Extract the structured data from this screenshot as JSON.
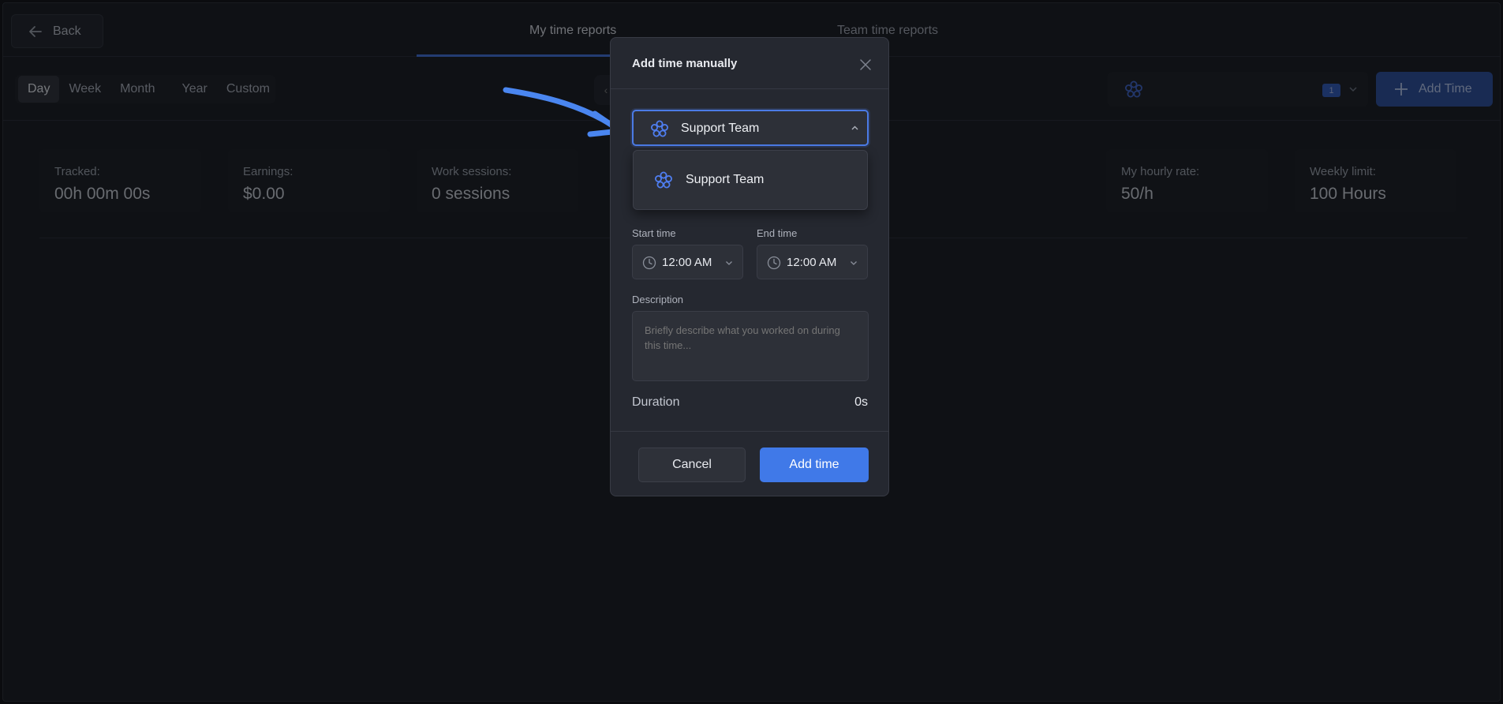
{
  "header": {
    "back_label": "Back",
    "tabs": [
      {
        "label": "My time reports",
        "active": true
      },
      {
        "label": "Team time reports",
        "active": false
      }
    ]
  },
  "toolbar": {
    "periods": [
      "Day",
      "Week",
      "Month",
      "Year",
      "Custom"
    ],
    "active_period": "Day",
    "team_count": "1",
    "add_time_label": "Add Time"
  },
  "stats": [
    {
      "label": "Tracked:",
      "value": "00h 00m 00s"
    },
    {
      "label": "Earnings:",
      "value": "$0.00"
    },
    {
      "label": "Work sessions:",
      "value": "0 sessions"
    },
    {
      "label": "My hourly rate:",
      "value": "50/h"
    },
    {
      "label": "Weekly limit:",
      "value": "100 Hours"
    }
  ],
  "modal": {
    "title": "Add time manually",
    "team_select_value": "Support Team",
    "team_options": [
      "Support Team"
    ],
    "start_time_label": "Start time",
    "start_time_value": "12:00 AM",
    "end_time_label": "End time",
    "end_time_value": "12:00 AM",
    "description_label": "Description",
    "description_placeholder": "Briefly describe what you worked on during this time...",
    "duration_label": "Duration",
    "duration_value": "0s",
    "cancel_label": "Cancel",
    "submit_label": "Add time"
  },
  "icons": {
    "back": "arrow-left-icon",
    "team": "team-flower-icon",
    "close": "close-icon",
    "clock": "clock-icon",
    "chevron": "chevron-down-icon",
    "plus": "plus-icon"
  },
  "colors": {
    "accent": "#4079e8",
    "background": "#16181e",
    "modal": "#252830",
    "annotation_arrow": "#4a86f0"
  }
}
